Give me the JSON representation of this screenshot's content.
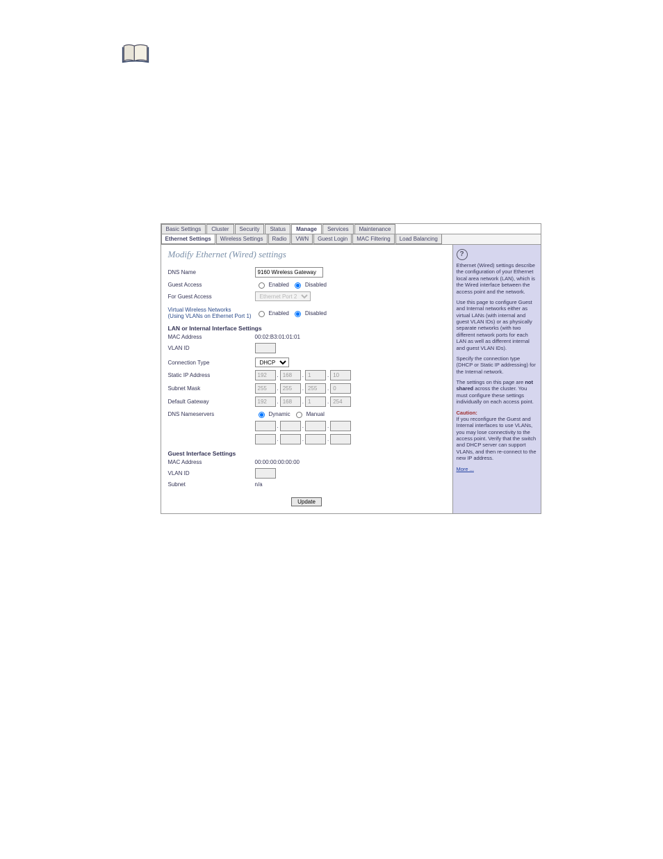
{
  "tabs": {
    "items": [
      "Basic Settings",
      "Cluster",
      "Security",
      "Status",
      "Manage",
      "Services",
      "Maintenance"
    ],
    "active": 4
  },
  "subtabs": {
    "items": [
      "Ethernet Settings",
      "Wireless Settings",
      "Radio",
      "VWN",
      "Guest Login",
      "MAC Filtering",
      "Load Balancing"
    ],
    "active": 0
  },
  "page_title": "Modify Ethernet (Wired) settings",
  "dns_name": {
    "label": "DNS Name",
    "value": "9160 Wireless Gateway"
  },
  "guest_access": {
    "label": "Guest Access",
    "enabled_label": "Enabled",
    "disabled_label": "Disabled",
    "selected": "Disabled"
  },
  "for_guest_access": {
    "label": "For Guest Access",
    "value": "Ethernet Port 2"
  },
  "vwn": {
    "label_line1": "Virtual Wireless Networks",
    "label_line2": "(Using VLANs on Ethernet Port 1)",
    "enabled_label": "Enabled",
    "disabled_label": "Disabled",
    "selected": "Disabled"
  },
  "lan_section": {
    "header": "LAN or Internal Interface Settings",
    "mac": {
      "label": "MAC Address",
      "value": "00:02:B3:01:01:01"
    },
    "vlan": {
      "label": "VLAN ID",
      "value": ""
    },
    "conn_type": {
      "label": "Connection Type",
      "value": "DHCP"
    },
    "static_ip": {
      "label": "Static IP Address",
      "oct": [
        "192",
        "168",
        "1",
        "10"
      ]
    },
    "subnet": {
      "label": "Subnet Mask",
      "oct": [
        "255",
        "255",
        "255",
        "0"
      ]
    },
    "gateway": {
      "label": "Default Gateway",
      "oct": [
        "192",
        "168",
        "1",
        "254"
      ]
    },
    "dns": {
      "label": "DNS Nameservers",
      "dynamic_label": "Dynamic",
      "manual_label": "Manual",
      "selected": "Dynamic"
    }
  },
  "guest_section": {
    "header": "Guest Interface Settings",
    "mac": {
      "label": "MAC Address",
      "value": "00:00:00:00:00:00"
    },
    "vlan": {
      "label": "VLAN ID",
      "value": ""
    },
    "subnet": {
      "label": "Subnet",
      "value": "n/a"
    }
  },
  "update_button": "Update",
  "help": {
    "p1": "Ethernet (Wired) settings describe the configuration of your Ethernet local area network (LAN), which is the Wired interface between the access point and the network.",
    "p2": "Use this page to configure Guest and Internal networks either as virtual LANs (with internal and guest VLAN IDs) or as physically separate networks (with two different network ports for each LAN as well as different internal and guest VLAN IDs).",
    "p3": "Specify the connection type (DHCP or Static IP addressing) for the Internal network.",
    "p4a": "The settings on this page are ",
    "p4b": "not shared",
    "p4c": " across the cluster. You must configure these settings individually on each access point.",
    "caution_label": "Caution:",
    "caution": "If you reconfigure the Guest and Internal interfaces to use VLANs, you may lose connectivity to the access point. Verify that the switch and DHCP server can support VLANs, and then re-connect to the new IP address.",
    "more": "More ..."
  }
}
